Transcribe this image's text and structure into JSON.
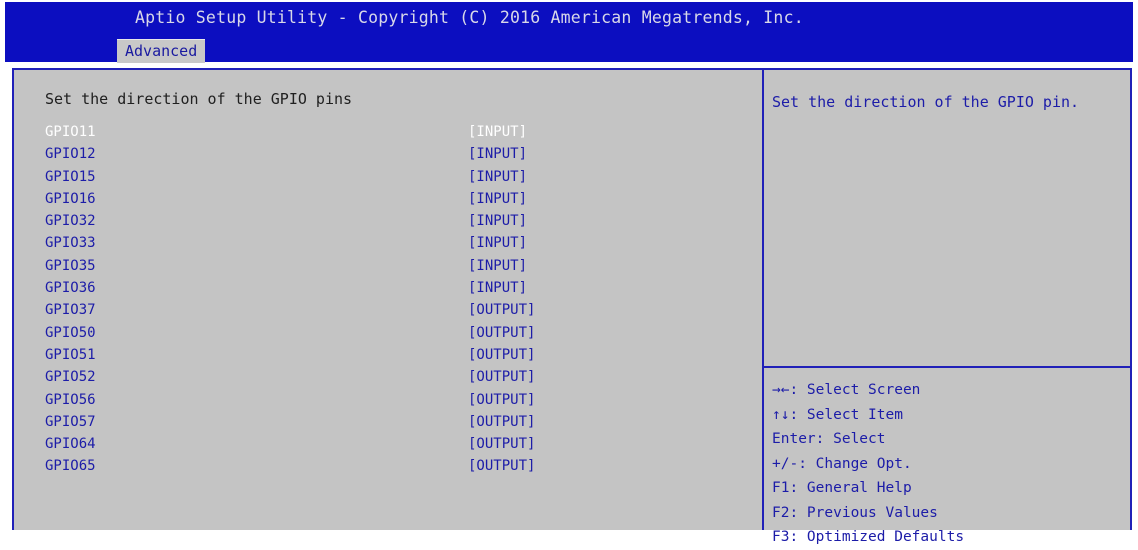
{
  "header": {
    "title": "Aptio Setup Utility - Copyright (C) 2016 American Megatrends, Inc.",
    "tab": "Advanced"
  },
  "main": {
    "heading": "Set the direction of the GPIO pins",
    "items": [
      {
        "name": "GPIO11",
        "value": "[INPUT]"
      },
      {
        "name": "GPIO12",
        "value": "[INPUT]"
      },
      {
        "name": "GPIO15",
        "value": "[INPUT]"
      },
      {
        "name": "GPIO16",
        "value": "[INPUT]"
      },
      {
        "name": "GPIO32",
        "value": "[INPUT]"
      },
      {
        "name": "GPIO33",
        "value": "[INPUT]"
      },
      {
        "name": "GPIO35",
        "value": "[INPUT]"
      },
      {
        "name": "GPIO36",
        "value": "[INPUT]"
      },
      {
        "name": "GPIO37",
        "value": "[OUTPUT]"
      },
      {
        "name": "GPIO50",
        "value": "[OUTPUT]"
      },
      {
        "name": "GPIO51",
        "value": "[OUTPUT]"
      },
      {
        "name": "GPIO52",
        "value": "[OUTPUT]"
      },
      {
        "name": "GPIO56",
        "value": "[OUTPUT]"
      },
      {
        "name": "GPIO57",
        "value": "[OUTPUT]"
      },
      {
        "name": "GPIO64",
        "value": "[OUTPUT]"
      },
      {
        "name": "GPIO65",
        "value": "[OUTPUT]"
      }
    ]
  },
  "help": {
    "text": "Set the direction of the GPIO pin.",
    "keys": [
      "→←: Select Screen",
      "↑↓: Select Item",
      "Enter: Select",
      "+/-: Change Opt.",
      "F1: General Help",
      "F2: Previous Values",
      "F3: Optimized Defaults"
    ]
  },
  "colors": {
    "bar_blue": "#0c0ec0",
    "panel_gray": "#c4c4c4",
    "item_blue": "#1c1ca8",
    "selected_white": "#ffffff"
  }
}
